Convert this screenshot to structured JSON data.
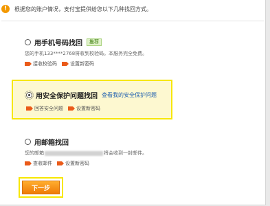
{
  "info": {
    "icon": "info-icon",
    "icon_glyph": "!",
    "text": "根据您的账户情况，支付宝提供给您以下几种找回方式。"
  },
  "options": [
    {
      "title": "用手机号码找回",
      "badge": "推荐",
      "desc": "您的手机133****2768将收到校验码。本服务完全免费。",
      "step1": "接收校验码",
      "step2": "设置新密码",
      "selected": false
    },
    {
      "title": "用安全保护问题找回",
      "link": "查看我的安全保护问题",
      "step1": "回答安全问题",
      "step2": "设置新密码",
      "selected": true
    },
    {
      "title": "用邮箱找回",
      "desc_prefix": "您的邮箱",
      "desc_suffix": "将会收到一封邮件。",
      "step1": "查收邮件",
      "step2": "设置新密码",
      "selected": false
    }
  ],
  "next_button": {
    "label": "下一步"
  },
  "colors": {
    "accent": "#ef7a06",
    "highlight_border": "#f7e700",
    "link": "#1e5fb0"
  }
}
